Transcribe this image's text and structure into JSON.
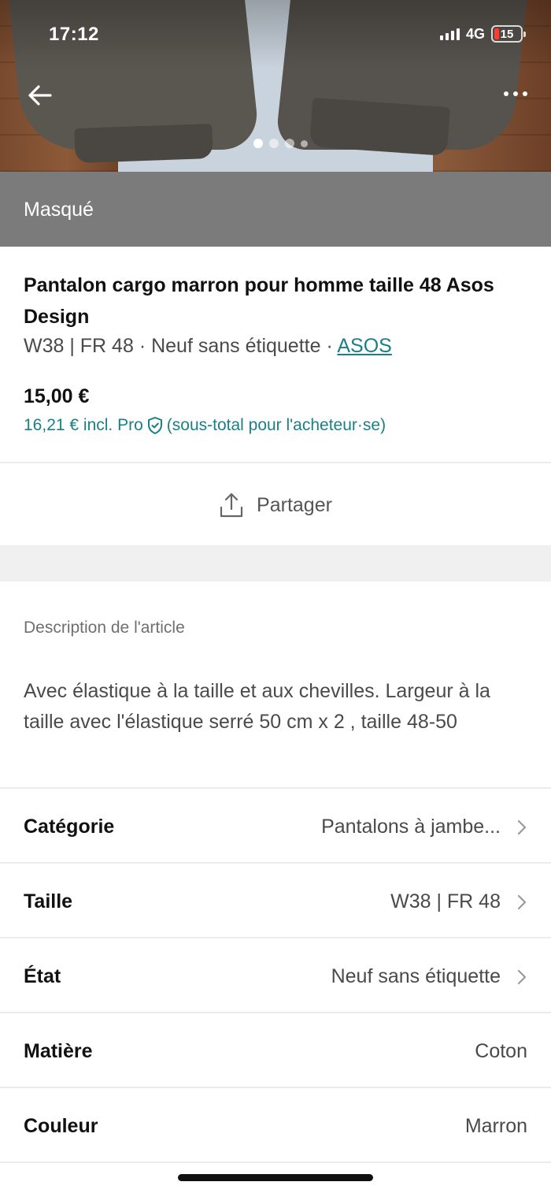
{
  "status_bar": {
    "time": "17:12",
    "network": "4G",
    "battery": "15",
    "battery_color": "#ff3b30"
  },
  "hero": {
    "photo_subject": "brown cargo trousers",
    "back_icon": "arrow-left-icon",
    "menu_icon": "more-horizontal-icon",
    "page_dots": 4,
    "active_dot": 1
  },
  "banner": {
    "text": "Masqué",
    "color": "#7b7b7b"
  },
  "item": {
    "title": "Pantalon cargo marron pour homme taille 48 Asos Design",
    "size": "W38 | FR 48",
    "dot1": " · ",
    "condition": "Neuf sans étiquette",
    "dot2": " · ",
    "brand": "ASOS",
    "price": "15,00 €",
    "pro_price": "16,21 € incl. Pro",
    "pro_note": "(sous-total pour l'acheteur·se)",
    "accent_color": "#1a7f86"
  },
  "share": {
    "label": "Partager",
    "icon": "share-icon"
  },
  "description": {
    "heading": "Description de l'article",
    "body": "Avec élastique à la taille et aux chevilles. Largeur à la taille avec l'élastique serré 50 cm x 2 , taille 48-50"
  },
  "attributes": [
    {
      "label": "Catégorie",
      "value": "Pantalons à jambe...",
      "chevron": true
    },
    {
      "label": "Taille",
      "value": "W38 | FR 48",
      "chevron": true
    },
    {
      "label": "État",
      "value": "Neuf sans étiquette",
      "chevron": true
    },
    {
      "label": "Matière",
      "value": "Coton",
      "chevron": false
    },
    {
      "label": "Couleur",
      "value": "Marron",
      "chevron": false
    }
  ]
}
